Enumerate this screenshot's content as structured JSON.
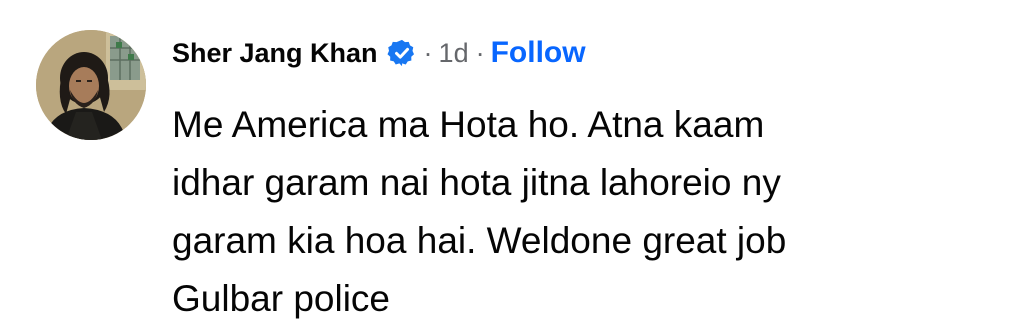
{
  "comment": {
    "author": "Sher Jang Khan",
    "verified_icon": "verified-badge-icon",
    "separator_1": "·",
    "timestamp": "1d",
    "separator_2": "·",
    "follow_label": "Follow",
    "text_lines": [
      "Me America ma Hota ho. Atna kaam",
      "idhar garam nai hota jitna lahoreio ny",
      "garam kia hoa hai. Weldone great job",
      "Gulbar police"
    ]
  },
  "colors": {
    "text": "#050505",
    "secondary_text": "#65676b",
    "link_blue": "#0866ff",
    "verified_blue": "#1877f2",
    "background": "#ffffff"
  }
}
